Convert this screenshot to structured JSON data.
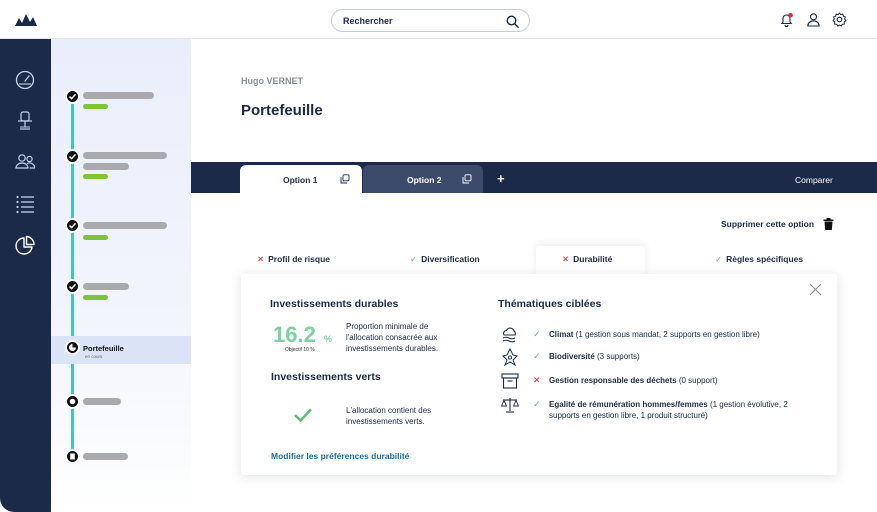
{
  "search": {
    "placeholder": "Rechercher"
  },
  "header": {
    "user": "Hugo VERNET",
    "title": "Portefeuille"
  },
  "stepper": {
    "active_title": "Portefeuille",
    "active_subtitle": "en cours"
  },
  "options": {
    "tabs": [
      {
        "label": "Option 1"
      },
      {
        "label": "Option 2"
      }
    ],
    "add": "+",
    "compare": "Comparer",
    "delete": "Supprimer cette option"
  },
  "criteria": [
    {
      "label": "Profil de risque",
      "mark": "✕"
    },
    {
      "label": "Diversification",
      "mark": "✓"
    },
    {
      "label": "Durabilité",
      "mark": "✕"
    },
    {
      "label": "Règles spécifiques",
      "mark": "✓"
    }
  ],
  "durability": {
    "sustainable_title": "Investissements durables",
    "percent": "16.2",
    "percent_unit": "%",
    "objective": "Objectif 10 %",
    "sustainable_desc_1": "Proportion minimale de",
    "sustainable_desc_2": "l'allocation consacrée aux",
    "sustainable_desc_3": "investissements durables.",
    "green_title": "Investissements verts",
    "green_desc_1": "L'allocation contient des",
    "green_desc_2": "investissements verts.",
    "modify_link": "Modifier les préférences durabilité",
    "themes_title": "Thématiques ciblées",
    "themes": [
      {
        "mark": "✓",
        "name": "Climat",
        "detail": " (1 gestion sous mandat, 2 supports en gestion libre)"
      },
      {
        "mark": "✓",
        "name": "Biodiversité",
        "detail": " (3 supports)"
      },
      {
        "mark": "✕",
        "name": "Gestion responsable des déchets",
        "detail": " (0 support)"
      },
      {
        "mark": "✓",
        "name": "Egalité de rémunération hommes/femmes",
        "detail": " (1 gestion évolutive, 2 supports en gestion libre, 1 produit structuré)"
      }
    ]
  },
  "colors": {
    "navy": "#1c2a4a",
    "accent_green": "#7bd1a0",
    "check_green": "#5cbf78",
    "error_red": "#e0283c",
    "link_blue": "#1a6fa8",
    "stepper_line": "#3ec8c2"
  }
}
